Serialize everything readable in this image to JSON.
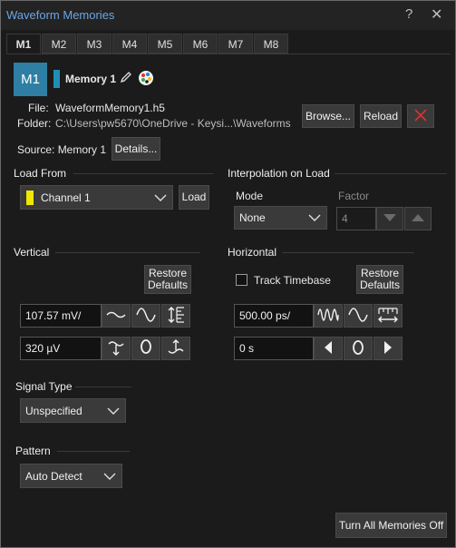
{
  "window": {
    "title": "Waveform Memories",
    "help_glyph": "?",
    "close_glyph": "✕"
  },
  "tabs": [
    "M1",
    "M2",
    "M3",
    "M4",
    "M5",
    "M6",
    "M7",
    "M8"
  ],
  "active_tab": "M1",
  "memory": {
    "badge": "M1",
    "name": "Memory 1",
    "color": "#1f8fb5",
    "file_label": "File:",
    "file_value": "WaveformMemory1.h5",
    "folder_label": "Folder:",
    "folder_value": "C:\\Users\\pw5670\\OneDrive - Keysi...\\Waveforms",
    "source": "Source: Memory 1",
    "browse_label": "Browse...",
    "reload_label": "Reload",
    "details_label": "Details..."
  },
  "load_from": {
    "header": "Load From",
    "channel": "Channel 1",
    "channel_color": "#f0e800",
    "load_label": "Load"
  },
  "interpolation": {
    "header": "Interpolation on Load",
    "mode_label": "Mode",
    "mode_value": "None",
    "factor_label": "Factor",
    "factor_value": "4"
  },
  "vertical": {
    "header": "Vertical",
    "restore_label": "Restore Defaults",
    "scale": "107.57 mV/",
    "offset": "320 µV"
  },
  "horizontal": {
    "header": "Horizontal",
    "track_label": "Track Timebase",
    "track_checked": false,
    "restore_label": "Restore Defaults",
    "scale": "500.00 ps/",
    "position": "0 s"
  },
  "signal_type": {
    "header": "Signal Type",
    "value": "Unspecified"
  },
  "pattern": {
    "header": "Pattern",
    "value": "Auto Detect"
  },
  "footer": {
    "turn_off_label": "Turn All Memories Off"
  },
  "colors": {
    "accent": "#6aa6e6",
    "badge": "#2e7fa3",
    "delete": "#e03030"
  }
}
